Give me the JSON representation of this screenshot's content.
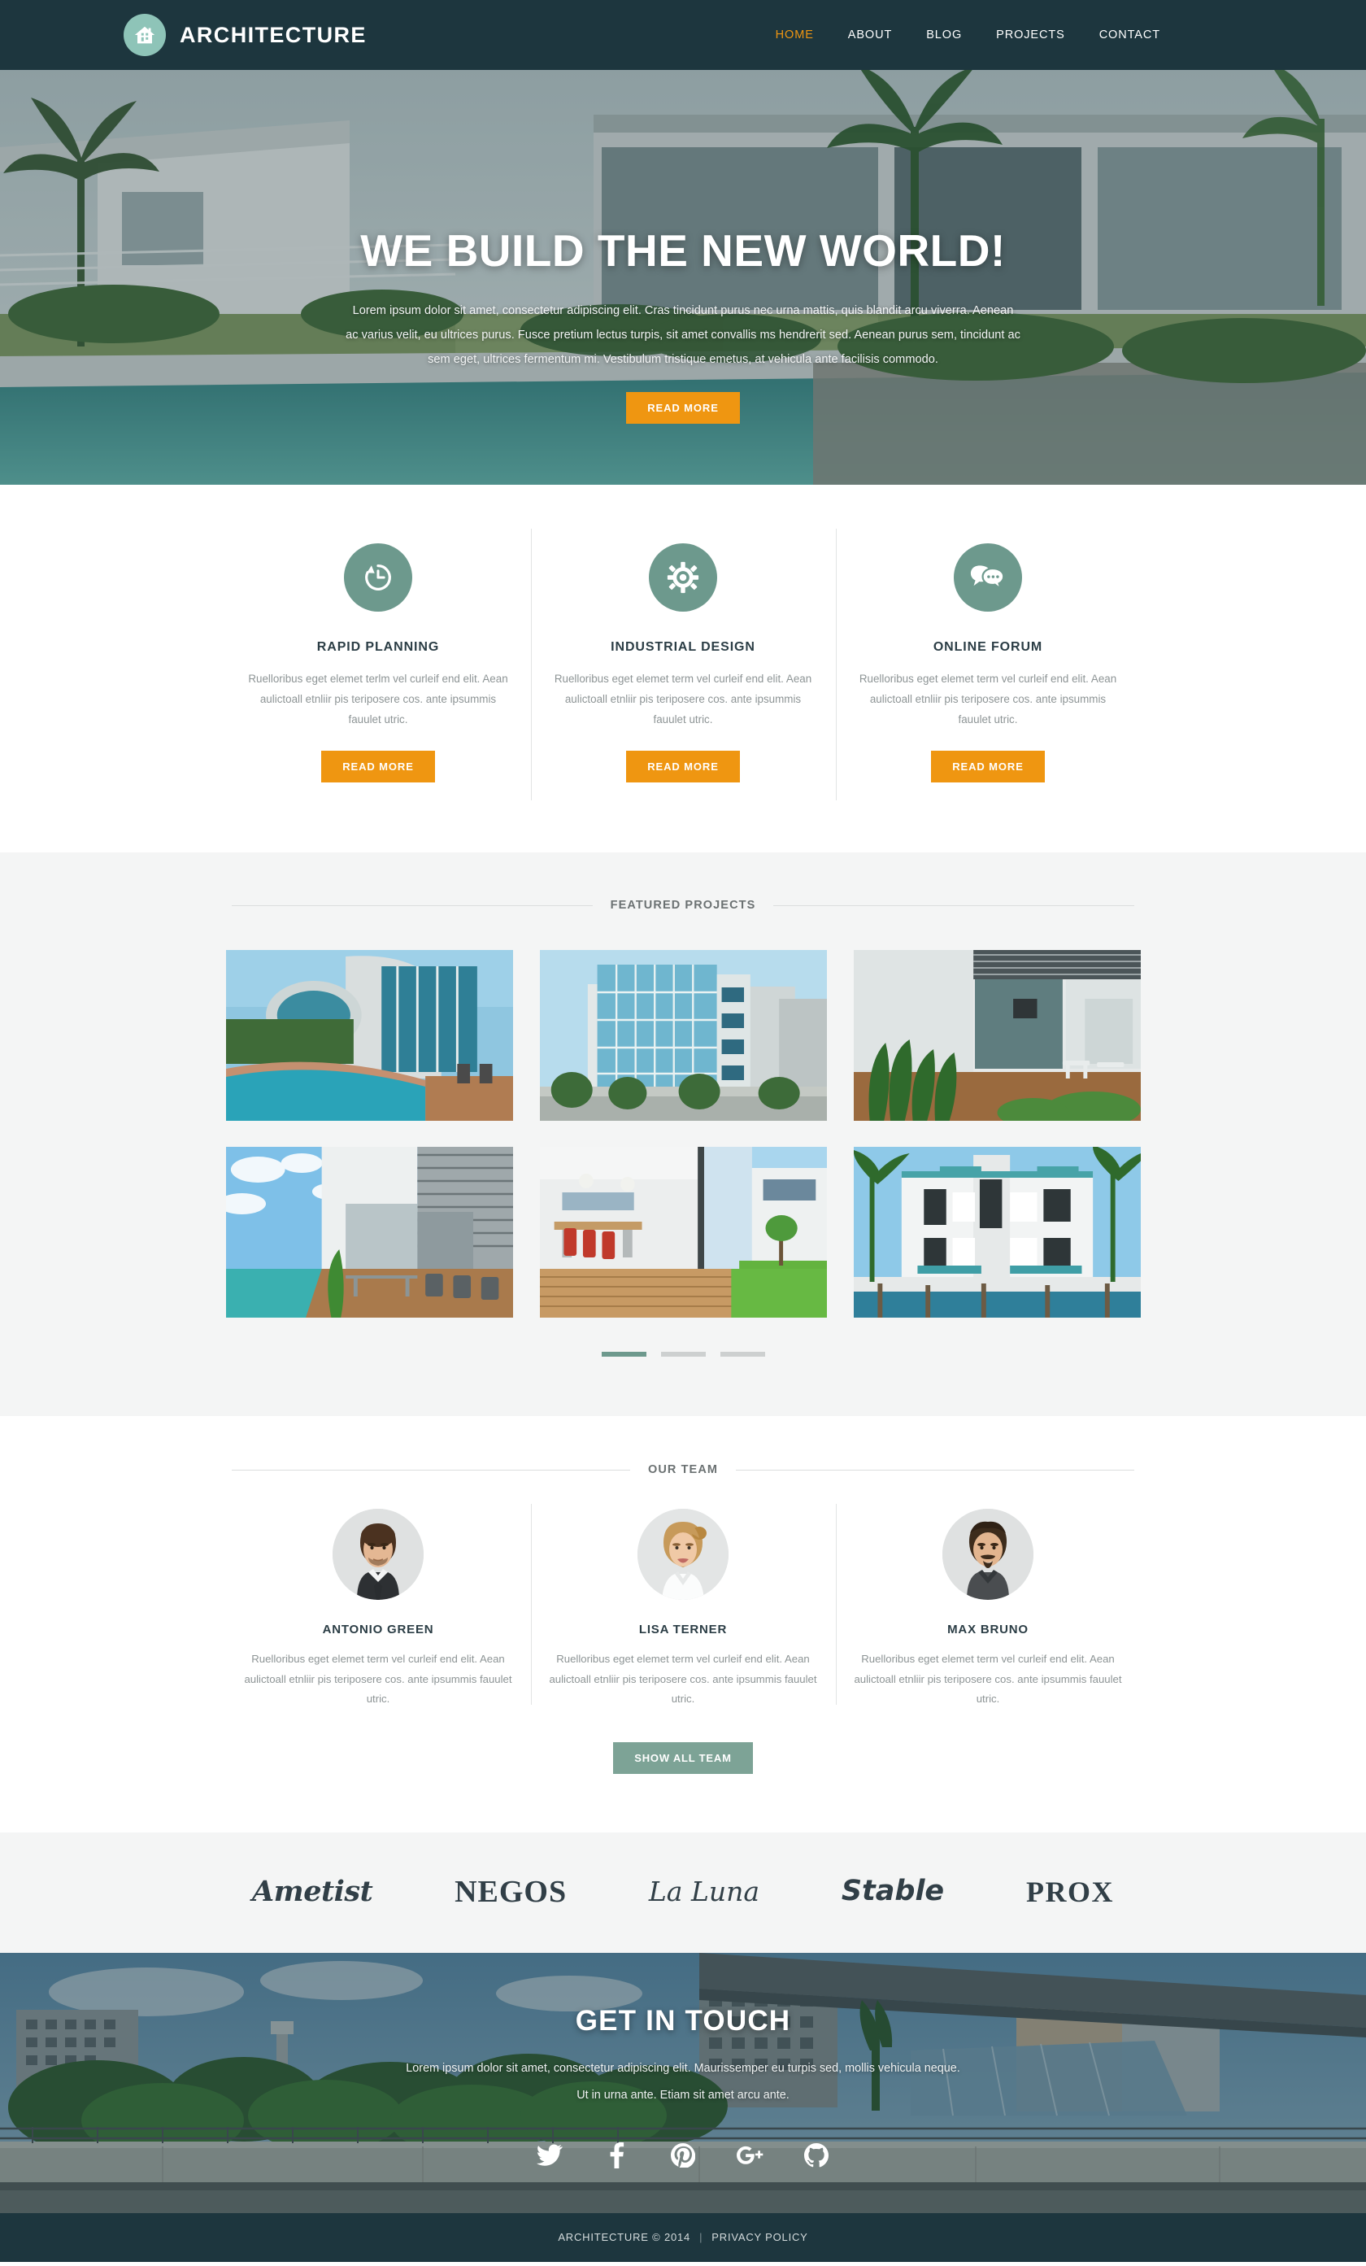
{
  "header": {
    "brand_name": "ARCHITECTURE",
    "logo_icon": "house-icon",
    "nav": [
      {
        "label": "HOME",
        "active": true
      },
      {
        "label": "ABOUT",
        "active": false
      },
      {
        "label": "BLOG",
        "active": false
      },
      {
        "label": "PROJECTS",
        "active": false
      },
      {
        "label": "CONTACT",
        "active": false
      }
    ]
  },
  "hero": {
    "title": "WE BUILD THE NEW WORLD!",
    "paragraph": "Lorem ipsum dolor sit amet, consectetur adipiscing elit. Cras tincidunt purus nec urna mattis, quis blandit arcu viverra. Aenean ac varius velit, eu ultrices purus. Fusce pretium lectus turpis, sit amet convallis ms hendrerit sed. Aenean purus sem, tincidunt ac sem eget, ultrices fermentum mi. Vestibulum tristique emetus, at vehicula ante facilisis commodo.",
    "cta_label": "READ MORE"
  },
  "services": [
    {
      "icon": "clock-history-icon",
      "title": "RAPID PLANNING",
      "text": "Ruelloribus eget elemet terlm vel curleif end elit. Aean aulictoall etnliir pis teriposere cos. ante ipsummis fauulet utric.",
      "cta_label": "READ MORE"
    },
    {
      "icon": "gear-icon",
      "title": "INDUSTRIAL DESIGN",
      "text": "Ruelloribus eget elemet term vel curleif end elit. Aean aulictoall etnliir pis teriposere cos. ante ipsummis fauulet utric.",
      "cta_label": "READ MORE"
    },
    {
      "icon": "chat-bubbles-icon",
      "title": "ONLINE FORUM",
      "text": "Ruelloribus eget elemet term vel curleif end elit. Aean aulictoall etnliir pis teriposere cos. ante ipsummis fauulet utric.",
      "cta_label": "READ MORE"
    }
  ],
  "projects": {
    "heading": "FEATURED PROJECTS",
    "items": [
      {
        "name": "modern-house-with-curved-pool"
      },
      {
        "name": "glass-office-tower"
      },
      {
        "name": "patio-with-tropical-plants"
      },
      {
        "name": "lap-pool-terrace-house"
      },
      {
        "name": "open-plan-dining-room"
      },
      {
        "name": "waterfront-white-villa"
      }
    ],
    "pagination": [
      {
        "active": true
      },
      {
        "active": false
      },
      {
        "active": false
      }
    ]
  },
  "team": {
    "heading": "OUR TEAM",
    "members": [
      {
        "name": "ANTONIO GREEN",
        "text": "Ruelloribus eget elemet term vel curleif end elit. Aean aulictoall etnliir pis teriposere cos. ante ipsummis fauulet utric.",
        "avatar": "man-in-suit-and-tie"
      },
      {
        "name": "LISA TERNER",
        "text": "Ruelloribus eget elemet term vel curleif end elit. Aean aulictoall etnliir pis teriposere cos. ante ipsummis fauulet utric.",
        "avatar": "blonde-woman-white-shirt"
      },
      {
        "name": "MAX BRUNO",
        "text": "Ruelloribus eget elemet term vel curleif end elit. Aean aulictoall etnliir pis teriposere cos. ante ipsummis fauulet utric.",
        "avatar": "man-with-goatee-grey-jacket"
      }
    ],
    "cta_label": "SHOW ALL TEAM"
  },
  "brands": [
    {
      "label": "Ametist",
      "style": "script-italic"
    },
    {
      "label": "NEGOS",
      "style": "serif-caps"
    },
    {
      "label": "La Luna",
      "style": "script"
    },
    {
      "label": "Stable",
      "style": "bold-italic"
    },
    {
      "label": "PROX",
      "style": "serif-caps"
    }
  ],
  "contact": {
    "title": "GET IN  TOUCH",
    "line1": "Lorem ipsum dolor sit amet, consectetur adipiscing elit. Maurissemper eu turpis sed, mollis vehicula neque.",
    "line2": "Ut in urna ante. Etiam sit amet arcu ante.",
    "socials": [
      {
        "name": "twitter-icon",
        "glyph": "twitter"
      },
      {
        "name": "facebook-icon",
        "glyph": "facebook"
      },
      {
        "name": "pinterest-icon",
        "glyph": "pinterest"
      },
      {
        "name": "google-plus-icon",
        "glyph": "googleplus"
      },
      {
        "name": "github-icon",
        "glyph": "github"
      }
    ]
  },
  "footer": {
    "copyright": "ARCHITECTURE © 2014",
    "separator": "|",
    "privacy_label": "PRIVACY POLICY"
  },
  "colors": {
    "dark_header": "#1d363e",
    "accent_orange": "#ef9611",
    "accent_green": "#6d998d",
    "button_green": "#7da396",
    "logo_circle": "#8ec4b8",
    "section_grey": "#f4f5f5",
    "body_text": "#8d9495",
    "heading_text": "#2b3d45"
  }
}
